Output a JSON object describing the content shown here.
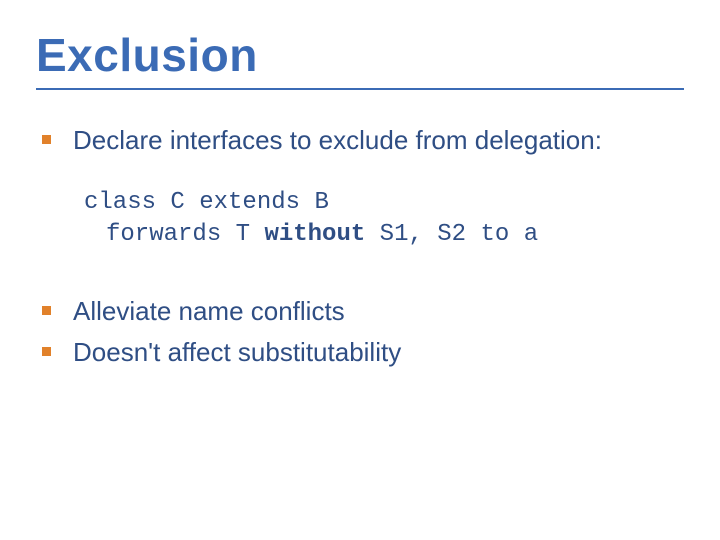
{
  "title": "Exclusion",
  "bullets": {
    "b1": "Declare interfaces to exclude from delegation:",
    "b2": "Alleviate name conflicts",
    "b3": "Doesn't affect substitutability"
  },
  "code": {
    "pre1": "class C extends B",
    "pre2a": "forwards T ",
    "kw": "without",
    "pre2b": " S1, S2 to a"
  }
}
